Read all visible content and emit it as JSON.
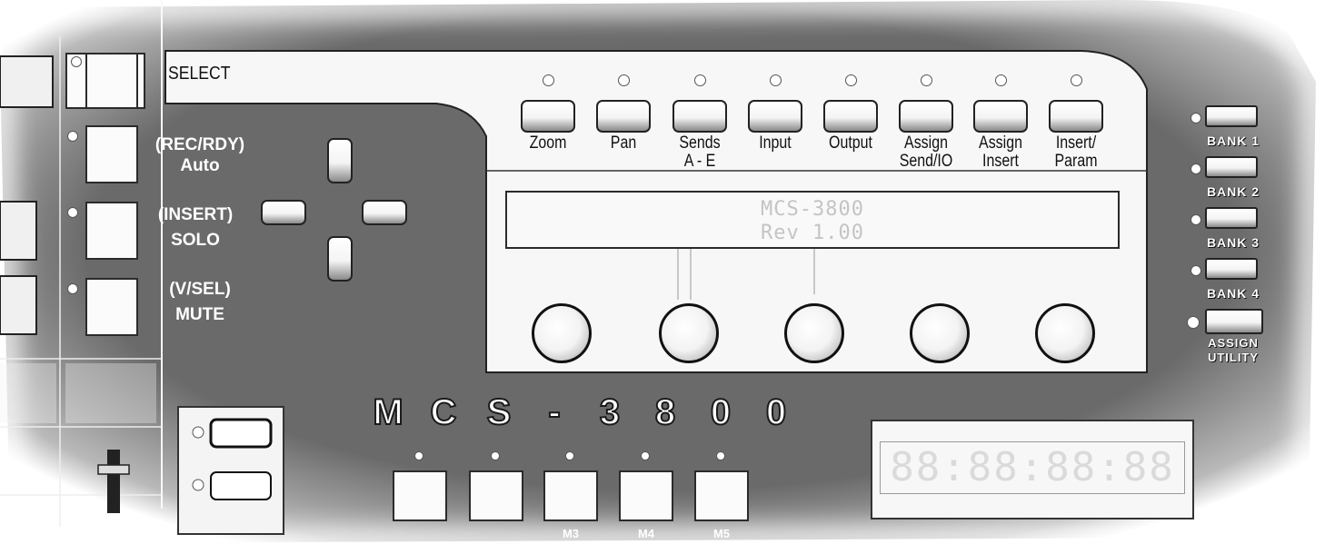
{
  "left_strip": {
    "select_label": "SELECT",
    "rows": [
      {
        "top": "(REC/RDY)",
        "bottom": "Auto"
      },
      {
        "top": "(INSERT)",
        "bottom": "SOLO"
      },
      {
        "top": "(V/SEL)",
        "bottom": "MUTE"
      }
    ]
  },
  "function_buttons": [
    {
      "label": "Zoom"
    },
    {
      "label": "Pan"
    },
    {
      "label": "Sends\nA - E"
    },
    {
      "label": "Input"
    },
    {
      "label": "Output"
    },
    {
      "label": "Assign\nSend/IO"
    },
    {
      "label": "Assign\nInsert"
    },
    {
      "label": "Insert/\nParam"
    }
  ],
  "lcd": {
    "line1": "MCS-3800",
    "line2": "Rev 1.00"
  },
  "knob_count": 5,
  "banks": [
    {
      "label": "BANK 1"
    },
    {
      "label": "BANK 2"
    },
    {
      "label": "BANK 3"
    },
    {
      "label": "BANK 4"
    },
    {
      "label": "ASSIGN\nUTILITY"
    }
  ],
  "logo": {
    "text": "MCS-3800"
  },
  "memory_buttons": [
    {
      "label": ""
    },
    {
      "label": ""
    },
    {
      "label": "M3"
    },
    {
      "label": "M4"
    },
    {
      "label": "M5"
    }
  ],
  "time_display": {
    "value": "88:88:88:88"
  }
}
